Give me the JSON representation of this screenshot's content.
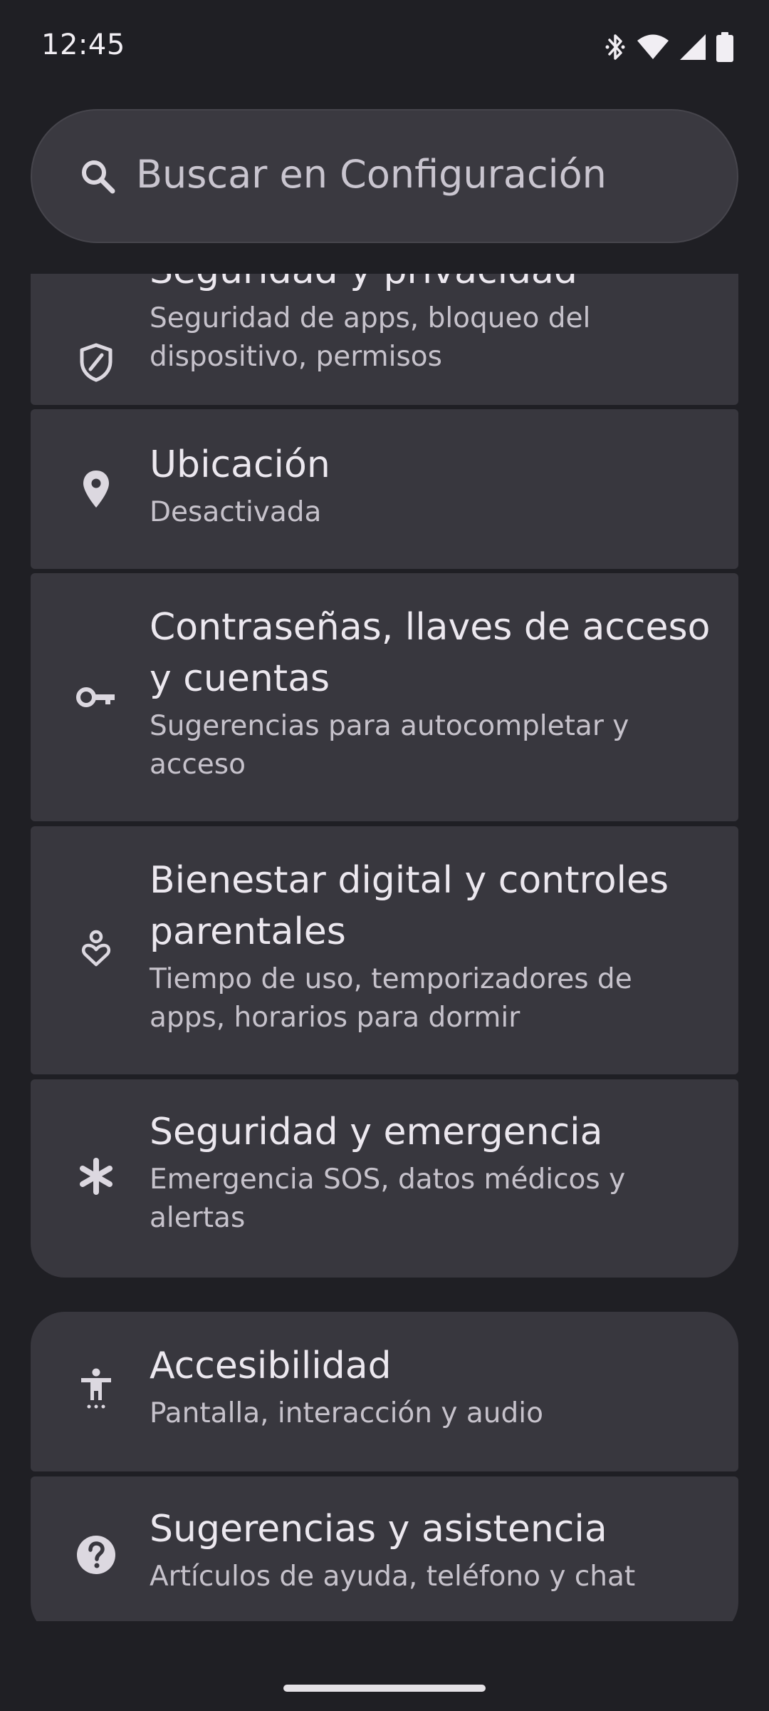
{
  "status_bar": {
    "time": "12:45",
    "icons": [
      "bluetooth-icon",
      "wifi-icon",
      "signal-icon",
      "battery-icon"
    ]
  },
  "search": {
    "placeholder": "Buscar en Configuración"
  },
  "settings_items": [
    {
      "icon": "shield-icon",
      "title": "Seguridad y privacidad",
      "subtitle": "Seguridad de apps, bloqueo del dispositivo, permisos"
    },
    {
      "icon": "location-pin-icon",
      "title": "Ubicación",
      "subtitle": "Desactivada"
    },
    {
      "icon": "key-icon",
      "title": "Contraseñas, llaves de acceso y cuentas",
      "subtitle": "Sugerencias para autocompletar y acceso"
    },
    {
      "icon": "digital-wellbeing-icon",
      "title": "Bienestar digital y controles parentales",
      "subtitle": "Tiempo de uso, temporizadores de apps, horarios para dormir"
    },
    {
      "icon": "asterisk-icon",
      "title": "Seguridad y emergencia",
      "subtitle": "Emergencia SOS, datos médicos y alertas"
    },
    {
      "icon": "accessibility-icon",
      "title": "Accesibilidad",
      "subtitle": "Pantalla, interacción y audio"
    },
    {
      "icon": "help-icon",
      "title": "Sugerencias y asistencia",
      "subtitle": "Artículos de ayuda, teléfono y chat"
    }
  ],
  "colors": {
    "background": "#1f1f24",
    "card": "#38373e",
    "search": "#3a3940",
    "title_text": "#ece8ef",
    "subtitle_text": "#c6c2cb"
  }
}
